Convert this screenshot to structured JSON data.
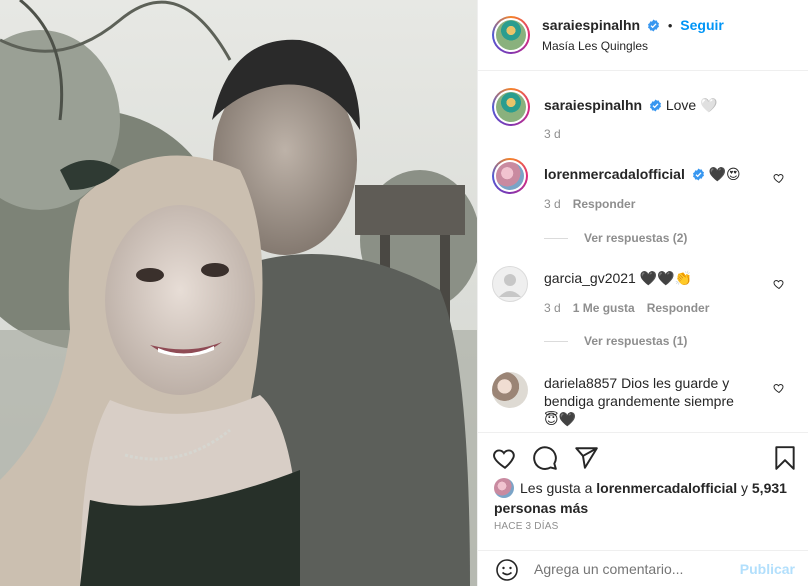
{
  "post": {
    "author": "saraiespinalhn",
    "follow_label": "Seguir",
    "separator": "•",
    "location": "Masía Les Quingles"
  },
  "caption": {
    "username": "saraiespinalhn",
    "text": "Love 🤍",
    "age": "3 d"
  },
  "comments": [
    {
      "username": "lorenmercadalofficial",
      "text": "🖤😍",
      "age": "3 d",
      "likes": "",
      "reply_label": "Responder",
      "view_replies": "Ver respuestas (2)"
    },
    {
      "username": "garcia_gv2021",
      "text": "🖤🖤👏",
      "age": "3 d",
      "likes": "1 Me gusta",
      "reply_label": "Responder",
      "view_replies": "Ver respuestas (1)"
    },
    {
      "username": "dariela8857",
      "text": "Dios les guarde y bendiga grandemente siempre😇🖤",
      "age": "",
      "likes": "",
      "reply_label": "",
      "view_replies": ""
    }
  ],
  "likes": {
    "prefix": "Les gusta a",
    "user": "lorenmercadalofficial",
    "connector": "y",
    "count": "5,931 personas más"
  },
  "timestamp": "HACE 3 DÍAS",
  "comment_box": {
    "placeholder": "Agrega un comentario...",
    "publish_label": "Publicar"
  },
  "icons": [
    "heart-icon",
    "comment-icon",
    "share-icon",
    "bookmark-icon",
    "emoji-icon",
    "verified-badge-icon"
  ],
  "colors": {
    "link_blue": "#0095f6",
    "publish_disabled": "#b2dffc",
    "verified": "#3897f0"
  }
}
